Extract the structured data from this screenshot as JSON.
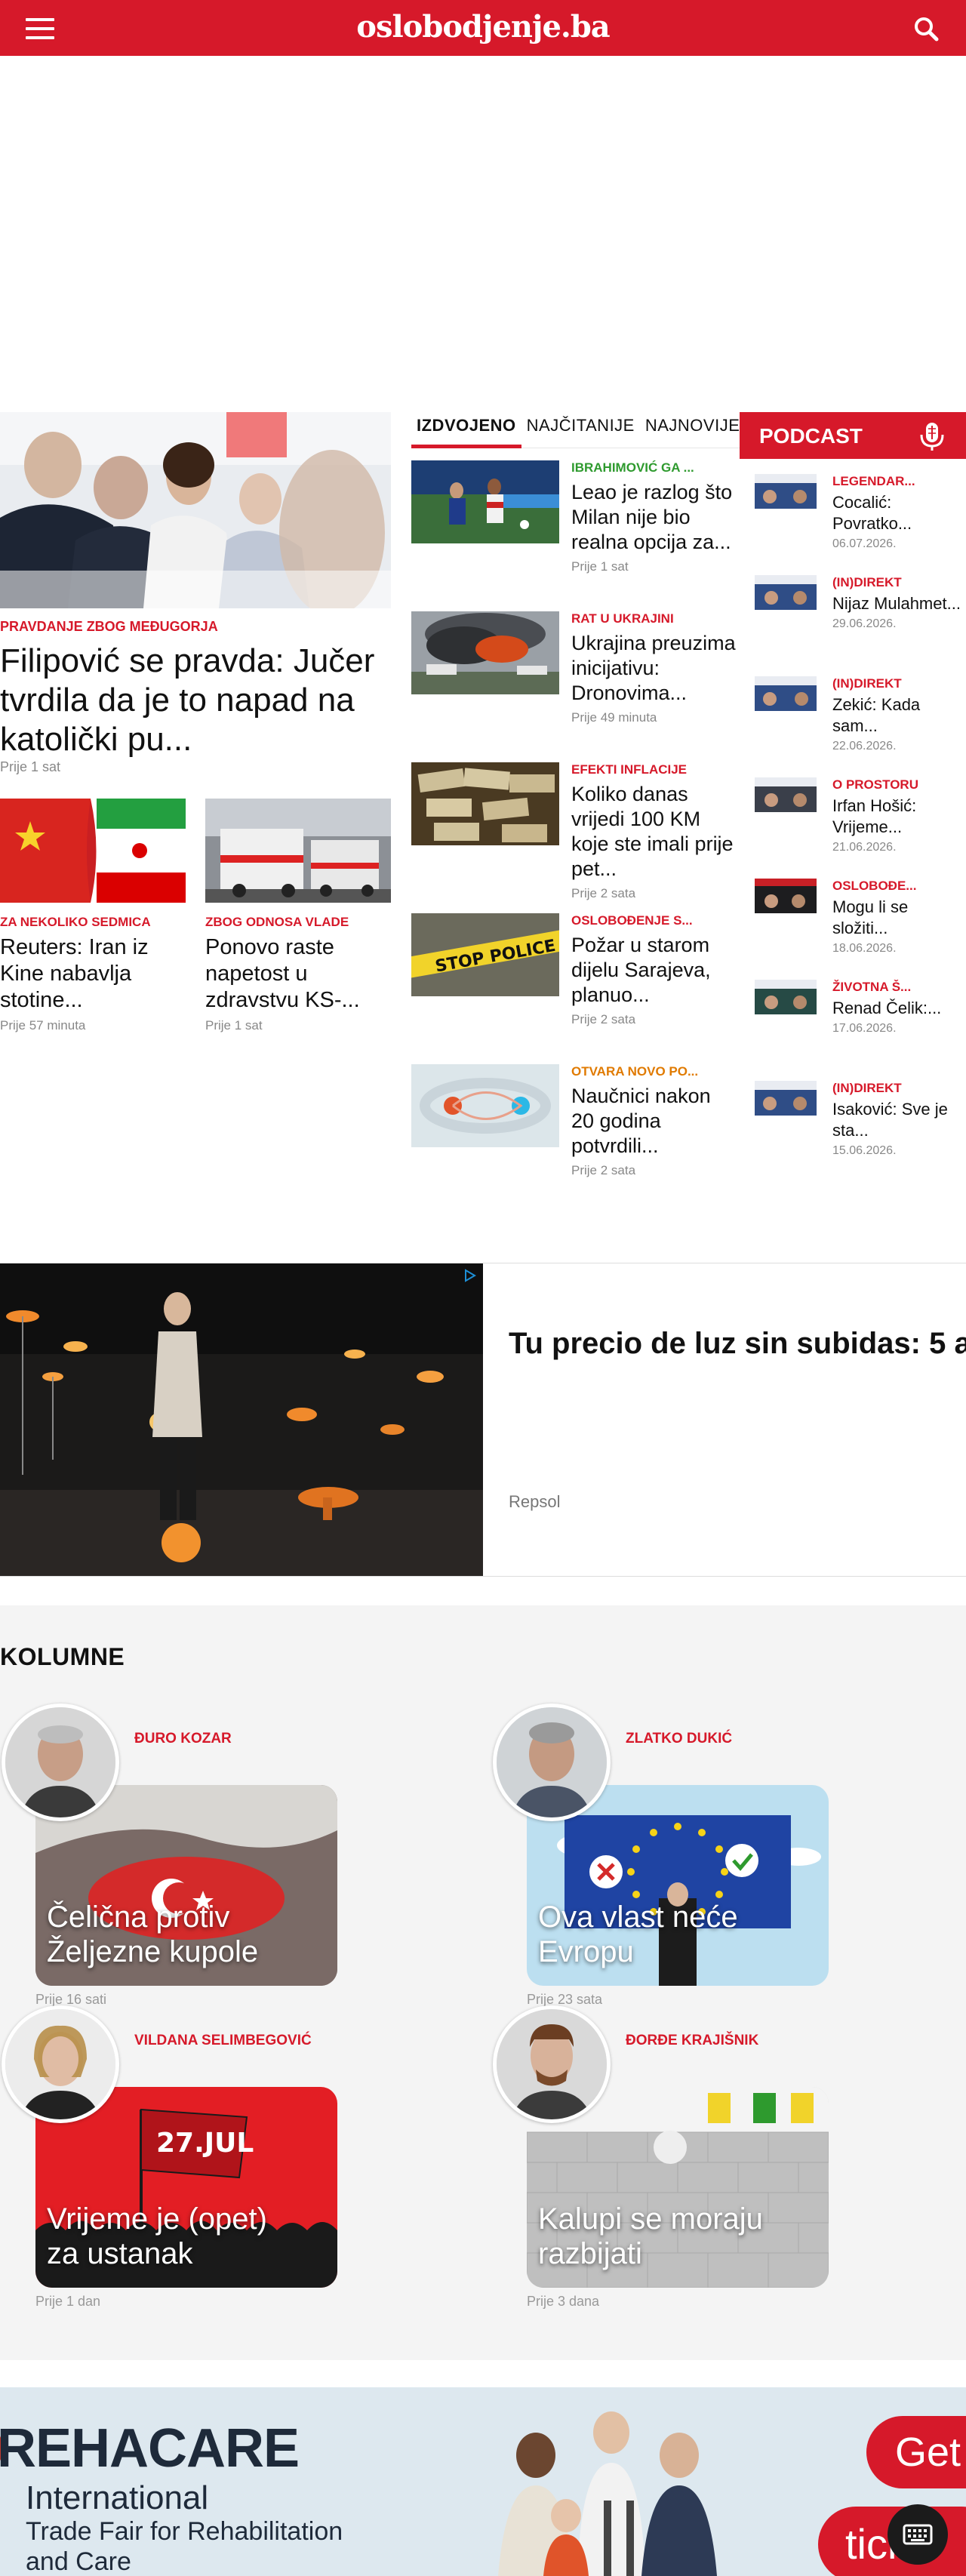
{
  "header": {
    "site_name": "oslobodjenje.ba",
    "menu_icon": "menu-icon",
    "search_icon": "search-icon",
    "brand_color": "#d6192a"
  },
  "lead": {
    "kicker": "PRAVDANJE ZBOG MEĐUGORJA",
    "title": "Filipović se pravda: Jučer tvrdila da je to napad na katolički pu...",
    "time": "Prije 1 sat"
  },
  "sub_stories": [
    {
      "kicker": "ZA NEKOLIKO SEDMICA",
      "title": "Reuters: Iran iz Kine nabavlja stotine...",
      "time": "Prije 57 minuta"
    },
    {
      "kicker": "ZBOG ODNOSA VLADE",
      "title": "Ponovo raste napetost u zdravstvu KS-...",
      "time": "Prije 1 sat"
    }
  ],
  "tabs": [
    {
      "label": "IZDVOJENO",
      "active": true
    },
    {
      "label": "NAJČITANIJE",
      "active": false
    },
    {
      "label": "NAJNOVIJE",
      "active": false
    }
  ],
  "featured": [
    {
      "kicker": "IBRAHIMOVIĆ GA ...",
      "kicker_color": "#2e9a2e",
      "title": "Leao je razlog što Milan nije bio realna opcija za...",
      "time": "Prije 1 sat"
    },
    {
      "kicker": "RAT U UKRAJINI",
      "kicker_color": "#d6192a",
      "title": "Ukrajina preuzima inicijativu: Dronovima...",
      "time": "Prije 49 minuta"
    },
    {
      "kicker": "EFEKTI INFLACIJE",
      "kicker_color": "#d6192a",
      "title": "Koliko danas vrijedi 100 KM koje ste imali prije pet...",
      "time": "Prije 2 sata"
    },
    {
      "kicker": "OSLOBOĐENJE S...",
      "kicker_color": "#d6192a",
      "title": "Požar u starom dijelu Sarajeva, planuo...",
      "time": "Prije 2 sata"
    },
    {
      "kicker": "OTVARA NOVO PO...",
      "kicker_color": "#e07a00",
      "title": "Naučnici nakon 20 godina potvrdili...",
      "time": "Prije 2 sata"
    }
  ],
  "podcast": {
    "title": "PODCAST",
    "icon": "microphone-icon",
    "items": [
      {
        "kicker": "LEGENDAR...",
        "title": "Cocalić: Povratko...",
        "date": "06.07.2026."
      },
      {
        "kicker": "(IN)DIREKT",
        "title": "Nijaz Mulahmet...",
        "date": "29.06.2026."
      },
      {
        "kicker": "(IN)DIREKT",
        "title": "Zekić: Kada sam...",
        "date": "22.06.2026."
      },
      {
        "kicker": "O PROSTORU",
        "title": "Irfan Hošić: Vrijeme...",
        "date": "21.06.2026."
      },
      {
        "kicker": "OSLOBOĐE...",
        "title": "Mogu li se složiti...",
        "date": "18.06.2026."
      },
      {
        "kicker": "ŽIVOTNA Š...",
        "title": "Renad Čelik:...",
        "date": "17.06.2026."
      },
      {
        "kicker": "(IN)DIREKT",
        "title": "Isaković: Sve je sta...",
        "date": "15.06.2026."
      }
    ]
  },
  "native_ad": {
    "headline": "Tu precio de luz sin subidas: 5 a",
    "brand": "Repsol",
    "adchoices_icon": "adchoices-icon"
  },
  "kolumne": {
    "section_title": "KOLUMNE",
    "items": [
      {
        "author": "ĐURO KOZAR",
        "title": "Čelična protiv Željezne kupole",
        "time": "Prije 16 sati"
      },
      {
        "author": "ZLATKO DUKIĆ",
        "title": "Ova vlast neće Evropu",
        "time": "Prije 23 sata"
      },
      {
        "author": "VILDANA SELIMBEGOVIĆ",
        "title": "Vrijeme je (opet) za ustanak",
        "time": "Prije 1 dan"
      },
      {
        "author": "ĐORĐE KRAJIŠNIK",
        "title": "Kalupi se moraju razbijati",
        "time": "Prije 3 dana"
      }
    ]
  },
  "bottom_ad": {
    "brand": "REHACARE",
    "subtitle": "International",
    "line1": "Trade Fair for Rehabilitation",
    "line2": "and Care",
    "cta1": "Get",
    "cta2": "tick"
  },
  "keyboard_icon": "keyboard-icon"
}
